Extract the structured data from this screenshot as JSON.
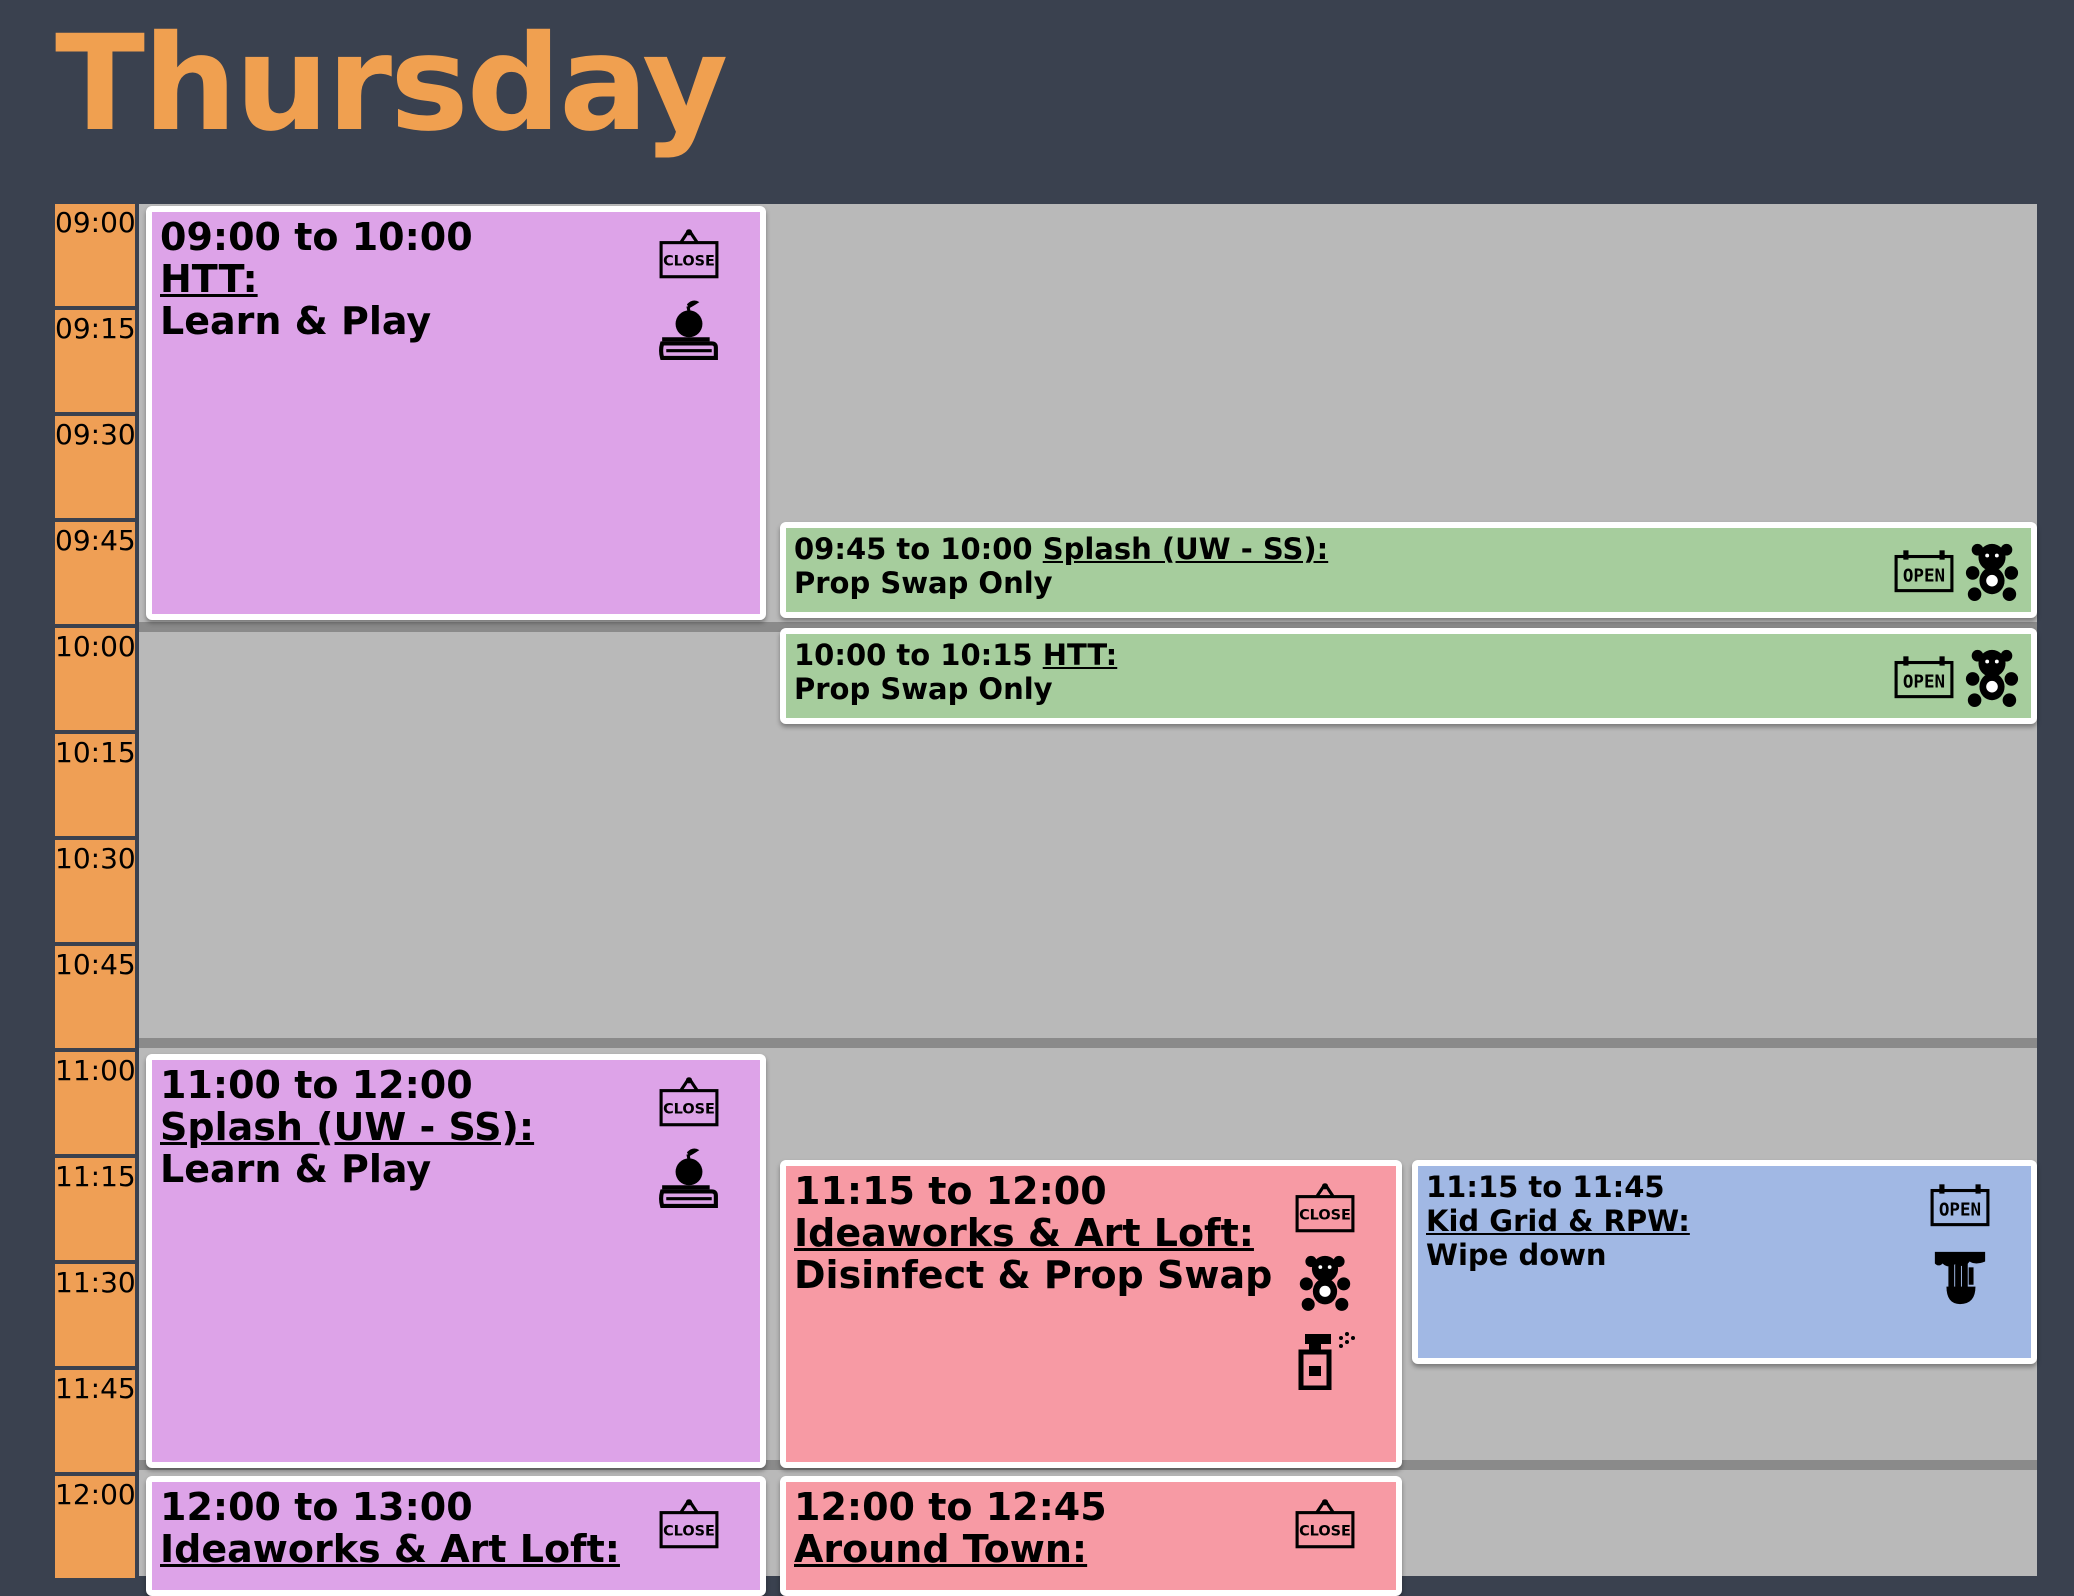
{
  "page": {
    "title": "Thursday"
  },
  "time_slots": [
    "09:00",
    "09:15",
    "09:30",
    "09:45",
    "10:00",
    "10:15",
    "10:30",
    "10:45",
    "11:00",
    "11:15",
    "11:30",
    "11:45",
    "12:00"
  ],
  "colors": {
    "title": "#f0a050",
    "background": "#3a414f",
    "time_slot": "#ef9f55",
    "learn_play": "#dda3e8",
    "prop_swap": "#a6cd9d",
    "disinfect": "#f79aa4",
    "wipe_down": "#a1b8e4"
  },
  "events": [
    {
      "time": "09:00 to 10:00",
      "location": "HTT:",
      "activity": "Learn & Play",
      "icons": [
        "close-sign-icon",
        "apple-book-icon"
      ]
    },
    {
      "time": "09:45 to 10:00",
      "location": "Splash (UW - SS):",
      "activity": "Prop Swap Only",
      "icons": [
        "open-sign-icon",
        "teddy-bear-icon"
      ]
    },
    {
      "time": "10:00 to 10:15",
      "location": "HTT:",
      "activity": "Prop Swap Only",
      "icons": [
        "open-sign-icon",
        "teddy-bear-icon"
      ]
    },
    {
      "time": "11:00 to 12:00",
      "location": "Splash (UW - SS):",
      "activity": "Learn & Play",
      "icons": [
        "close-sign-icon",
        "apple-book-icon"
      ]
    },
    {
      "time": "11:15 to 12:00",
      "location": "Ideaworks & Art Loft:",
      "activity": "Disinfect & Prop Swap",
      "icons": [
        "close-sign-icon",
        "teddy-bear-icon",
        "spray-bottle-icon"
      ]
    },
    {
      "time": "11:15 to 11:45",
      "location": "Kid Grid & RPW:",
      "activity": "Wipe down",
      "icons": [
        "open-sign-icon",
        "wipe-hand-icon"
      ]
    },
    {
      "time": "12:00 to 13:00",
      "location": "Ideaworks & Art Loft:",
      "activity": "",
      "icons": [
        "close-sign-icon"
      ]
    },
    {
      "time": "12:00 to 12:45",
      "location": "Around Town:",
      "activity": "",
      "icons": [
        "close-sign-icon"
      ]
    }
  ]
}
